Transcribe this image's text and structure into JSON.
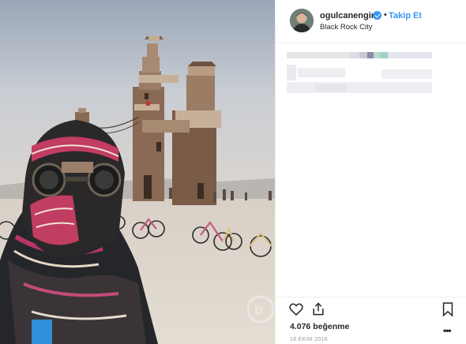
{
  "post": {
    "username": "ogulcanengin",
    "separator": "•",
    "follow_label": "Takip Et",
    "location": "Black Rock City",
    "likes": "4.076 beğenme",
    "date": "18 EKİM 2016",
    "more_label": "•••"
  },
  "photo": {
    "description_icon": "burning-man-tower-photo"
  },
  "colors": {
    "accent": "#3897f0",
    "text": "#262626",
    "muted": "#999999",
    "divider": "#efefef"
  }
}
